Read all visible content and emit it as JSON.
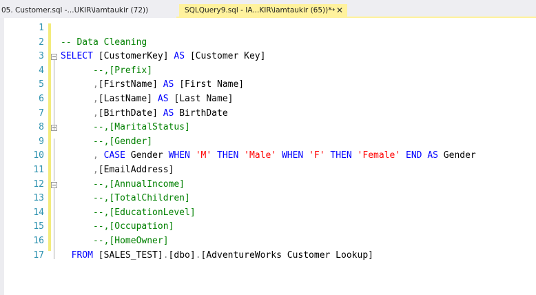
{
  "tabs": [
    {
      "label": "05. Customer.sql -...UKIR\\iamtaukir (72))",
      "active": false
    },
    {
      "label": "SQLQuery9.sql - IA...KIR\\iamtaukir (65))*",
      "active": true,
      "pin_glyph": "⇢",
      "close_glyph": "✕"
    }
  ],
  "line_numbers": [
    "1",
    "2",
    "3",
    "4",
    "5",
    "6",
    "7",
    "8",
    "9",
    "10",
    "11",
    "12",
    "13",
    "14",
    "15",
    "16",
    "17"
  ],
  "code_lines": [
    [],
    [
      {
        "t": "-- Data Cleaning",
        "c": "cm"
      }
    ],
    [
      {
        "t": "SELECT",
        "c": "kw"
      },
      {
        "t": " [CustomerKey] ",
        "c": "tx"
      },
      {
        "t": "AS",
        "c": "kw"
      },
      {
        "t": " [Customer Key]",
        "c": "tx"
      }
    ],
    [
      {
        "t": "      --,[Prefix]",
        "c": "cm"
      }
    ],
    [
      {
        "t": "      ",
        "c": "tx"
      },
      {
        "t": ",",
        "c": "gr"
      },
      {
        "t": "[FirstName] ",
        "c": "tx"
      },
      {
        "t": "AS",
        "c": "kw"
      },
      {
        "t": " [First Name]",
        "c": "tx"
      }
    ],
    [
      {
        "t": "      ",
        "c": "tx"
      },
      {
        "t": ",",
        "c": "gr"
      },
      {
        "t": "[LastName] ",
        "c": "tx"
      },
      {
        "t": "AS",
        "c": "kw"
      },
      {
        "t": " [Last Name]",
        "c": "tx"
      }
    ],
    [
      {
        "t": "      ",
        "c": "tx"
      },
      {
        "t": ",",
        "c": "gr"
      },
      {
        "t": "[BirthDate] ",
        "c": "tx"
      },
      {
        "t": "AS",
        "c": "kw"
      },
      {
        "t": " BirthDate",
        "c": "tx"
      }
    ],
    [
      {
        "t": "      --,[MaritalStatus]",
        "c": "cm"
      }
    ],
    [
      {
        "t": "      --,[Gender]",
        "c": "cm"
      }
    ],
    [
      {
        "t": "      ",
        "c": "tx"
      },
      {
        "t": ",",
        "c": "gr"
      },
      {
        "t": " ",
        "c": "tx"
      },
      {
        "t": "CASE",
        "c": "kw"
      },
      {
        "t": " Gender ",
        "c": "tx"
      },
      {
        "t": "WHEN",
        "c": "kw"
      },
      {
        "t": " ",
        "c": "tx"
      },
      {
        "t": "'M'",
        "c": "st"
      },
      {
        "t": " ",
        "c": "tx"
      },
      {
        "t": "THEN",
        "c": "kw"
      },
      {
        "t": " ",
        "c": "tx"
      },
      {
        "t": "'Male'",
        "c": "st"
      },
      {
        "t": " ",
        "c": "tx"
      },
      {
        "t": "WHEN",
        "c": "kw"
      },
      {
        "t": " ",
        "c": "tx"
      },
      {
        "t": "'F'",
        "c": "st"
      },
      {
        "t": " ",
        "c": "tx"
      },
      {
        "t": "THEN",
        "c": "kw"
      },
      {
        "t": " ",
        "c": "tx"
      },
      {
        "t": "'Female'",
        "c": "st"
      },
      {
        "t": " ",
        "c": "tx"
      },
      {
        "t": "END",
        "c": "kw"
      },
      {
        "t": " ",
        "c": "tx"
      },
      {
        "t": "AS",
        "c": "kw"
      },
      {
        "t": " Gender",
        "c": "tx"
      }
    ],
    [
      {
        "t": "      ",
        "c": "tx"
      },
      {
        "t": ",",
        "c": "gr"
      },
      {
        "t": "[EmailAddress]",
        "c": "tx"
      }
    ],
    [
      {
        "t": "      --,[AnnualIncome]",
        "c": "cm"
      }
    ],
    [
      {
        "t": "      --,[TotalChildren]",
        "c": "cm"
      }
    ],
    [
      {
        "t": "      --,[EducationLevel]",
        "c": "cm"
      }
    ],
    [
      {
        "t": "      --,[Occupation]",
        "c": "cm"
      }
    ],
    [
      {
        "t": "      --,[HomeOwner]",
        "c": "cm"
      }
    ],
    [
      {
        "t": "  ",
        "c": "tx"
      },
      {
        "t": "FROM",
        "c": "kw"
      },
      {
        "t": " [SALES_TEST]",
        "c": "tx"
      },
      {
        "t": ".",
        "c": "gr"
      },
      {
        "t": "[dbo]",
        "c": "tx"
      },
      {
        "t": ".",
        "c": "gr"
      },
      {
        "t": "[AdventureWorks Customer Lookup]",
        "c": "tx"
      }
    ]
  ],
  "fold_markers": [
    3,
    8,
    12
  ]
}
